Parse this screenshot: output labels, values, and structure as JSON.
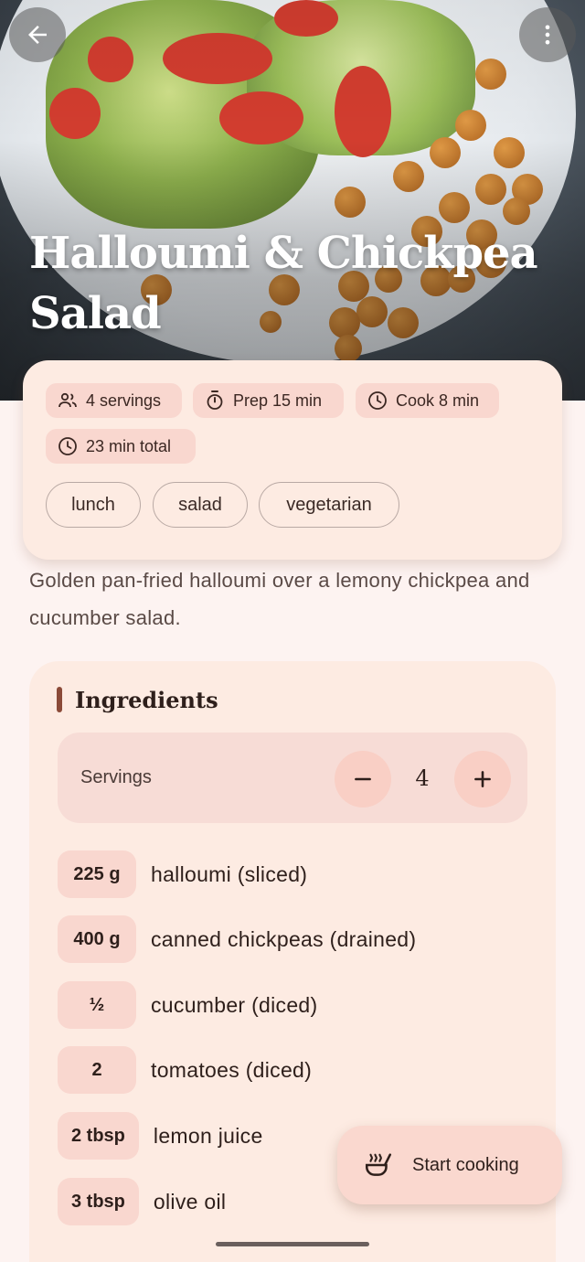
{
  "header": {
    "title": "Halloumi & Chickpea Salad",
    "back_icon": "arrow-back-icon",
    "menu_icon": "more-vert-icon"
  },
  "meta": {
    "chips": [
      {
        "icon": "people-icon",
        "label": "4 servings"
      },
      {
        "icon": "timer-icon",
        "label": "Prep 15 min"
      },
      {
        "icon": "clock-icon",
        "label": "Cook 8 min"
      },
      {
        "icon": "clock-icon",
        "label": "23 min total"
      }
    ],
    "tags": [
      "lunch",
      "salad",
      "vegetarian"
    ]
  },
  "description": "Golden pan-fried halloumi over a lemony chickpea and cucumber salad.",
  "ingredients": {
    "title": "Ingredients",
    "servings_label": "Servings",
    "servings_value": "4",
    "items": [
      {
        "qty": "225 g",
        "name": "halloumi (sliced)"
      },
      {
        "qty": "400 g",
        "name": "canned chickpeas (drained)"
      },
      {
        "qty": "½",
        "name": "cucumber (diced)"
      },
      {
        "qty": "2",
        "name": "tomatoes (diced)"
      },
      {
        "qty": "2 tbsp",
        "name": "lemon juice"
      },
      {
        "qty": "3 tbsp",
        "name": "olive oil"
      }
    ]
  },
  "fab": {
    "label": "Start cooking",
    "icon": "cooking-pot-icon"
  },
  "colors": {
    "accent": "#8b4a38",
    "chip": "#f9d7cf",
    "card": "#fdebe2",
    "background": "#fdf3f1"
  }
}
